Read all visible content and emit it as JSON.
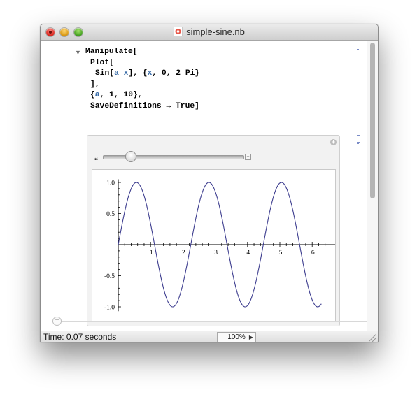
{
  "window": {
    "title": "simple-sine.nb",
    "icon": "mathematica-notebook-icon"
  },
  "code": {
    "line1": "Manipulate[",
    "line2": "Plot[",
    "line3_fn": "Sin[",
    "line3_arg": "a x",
    "line3_rest": "], {",
    "line3_var": "x",
    "line3_end": ", 0, 2 Pi}",
    "line4": "],",
    "line5_open": "{",
    "line5_var": "a",
    "line5_rest": ", 1, 10},",
    "line6": "SaveDefinitions → True]"
  },
  "manipulate": {
    "variable_label": "a",
    "slider_value": 2.8,
    "slider_min": 1,
    "slider_max": 10
  },
  "chart_data": {
    "type": "line",
    "function": "sin(a x)",
    "a": 2.8,
    "x_range": [
      0,
      6.283
    ],
    "ylim": [
      -1.0,
      1.0
    ],
    "x_ticks": [
      "1",
      "2",
      "3",
      "4",
      "5",
      "6"
    ],
    "y_ticks": [
      "1.0",
      "0.5",
      "-0.5",
      "-1.0"
    ],
    "color": "#3d3d8f"
  },
  "status": {
    "text": "Time: 0.07 seconds",
    "zoom": "100%"
  },
  "colors": {
    "code_symbol": "#3a6da8",
    "bracket": "#7a8cc7"
  }
}
